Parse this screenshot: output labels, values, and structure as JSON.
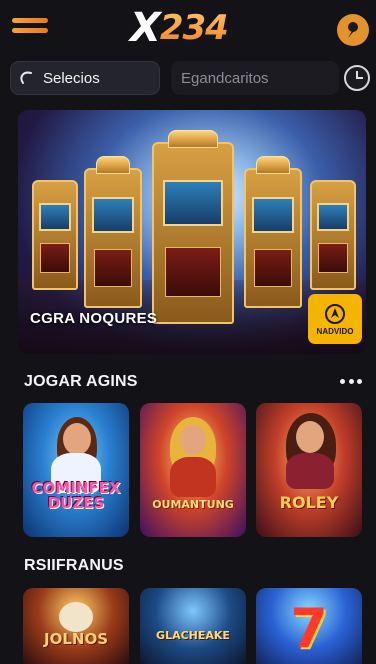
{
  "header": {
    "logo_x": "X",
    "logo_num": "234",
    "brand_color": "#ef8a22",
    "menu_icon": "hamburger-icon",
    "profile_icon": "profile-icon"
  },
  "search": {
    "select_label": "Selecios",
    "placeholder": "Egandcaritos",
    "clock_icon": "clock-icon"
  },
  "banner": {
    "title": "CGRA NOQURES",
    "badge_label": "NADVIDO",
    "badge_color": "#f5b400"
  },
  "section_1": {
    "title": "JOGAR AGINS",
    "games": [
      {
        "label": "COMINFEX DUZES",
        "label_color": "#ff3e9a"
      },
      {
        "label": "OUMANTUNG",
        "label_color": "#ffd34a"
      },
      {
        "label": "ROLEY",
        "label_color": "#ffcf3a"
      }
    ]
  },
  "section_2": {
    "title": "RSIIFRANUS",
    "games": [
      {
        "label": "JOLNOS"
      },
      {
        "label": "GLACHEAKE"
      },
      {
        "label": "7"
      }
    ]
  }
}
